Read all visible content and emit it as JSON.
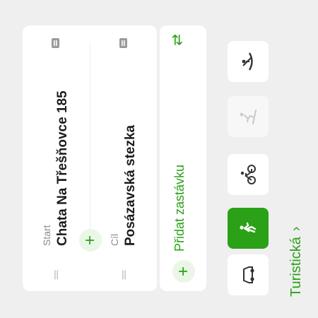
{
  "route": {
    "start_label": "Start",
    "start_value": "Chata Na Třešňovce 185",
    "dest_label": "Cíl",
    "dest_value": "Posázavská stezka"
  },
  "stops": {
    "add_label": "Přidat zastávku"
  },
  "modes": [
    "car",
    "hiking",
    "cycling",
    "ski",
    "canoe"
  ],
  "mode_icons": [
    "car-icon",
    "hiking-icon",
    "cycling-icon",
    "ski-icon",
    "canoe-icon"
  ],
  "selected_mode": "hiking",
  "route_type": {
    "label": "Turistická"
  },
  "colors": {
    "accent": "#2aa117",
    "background": "#efefef"
  }
}
